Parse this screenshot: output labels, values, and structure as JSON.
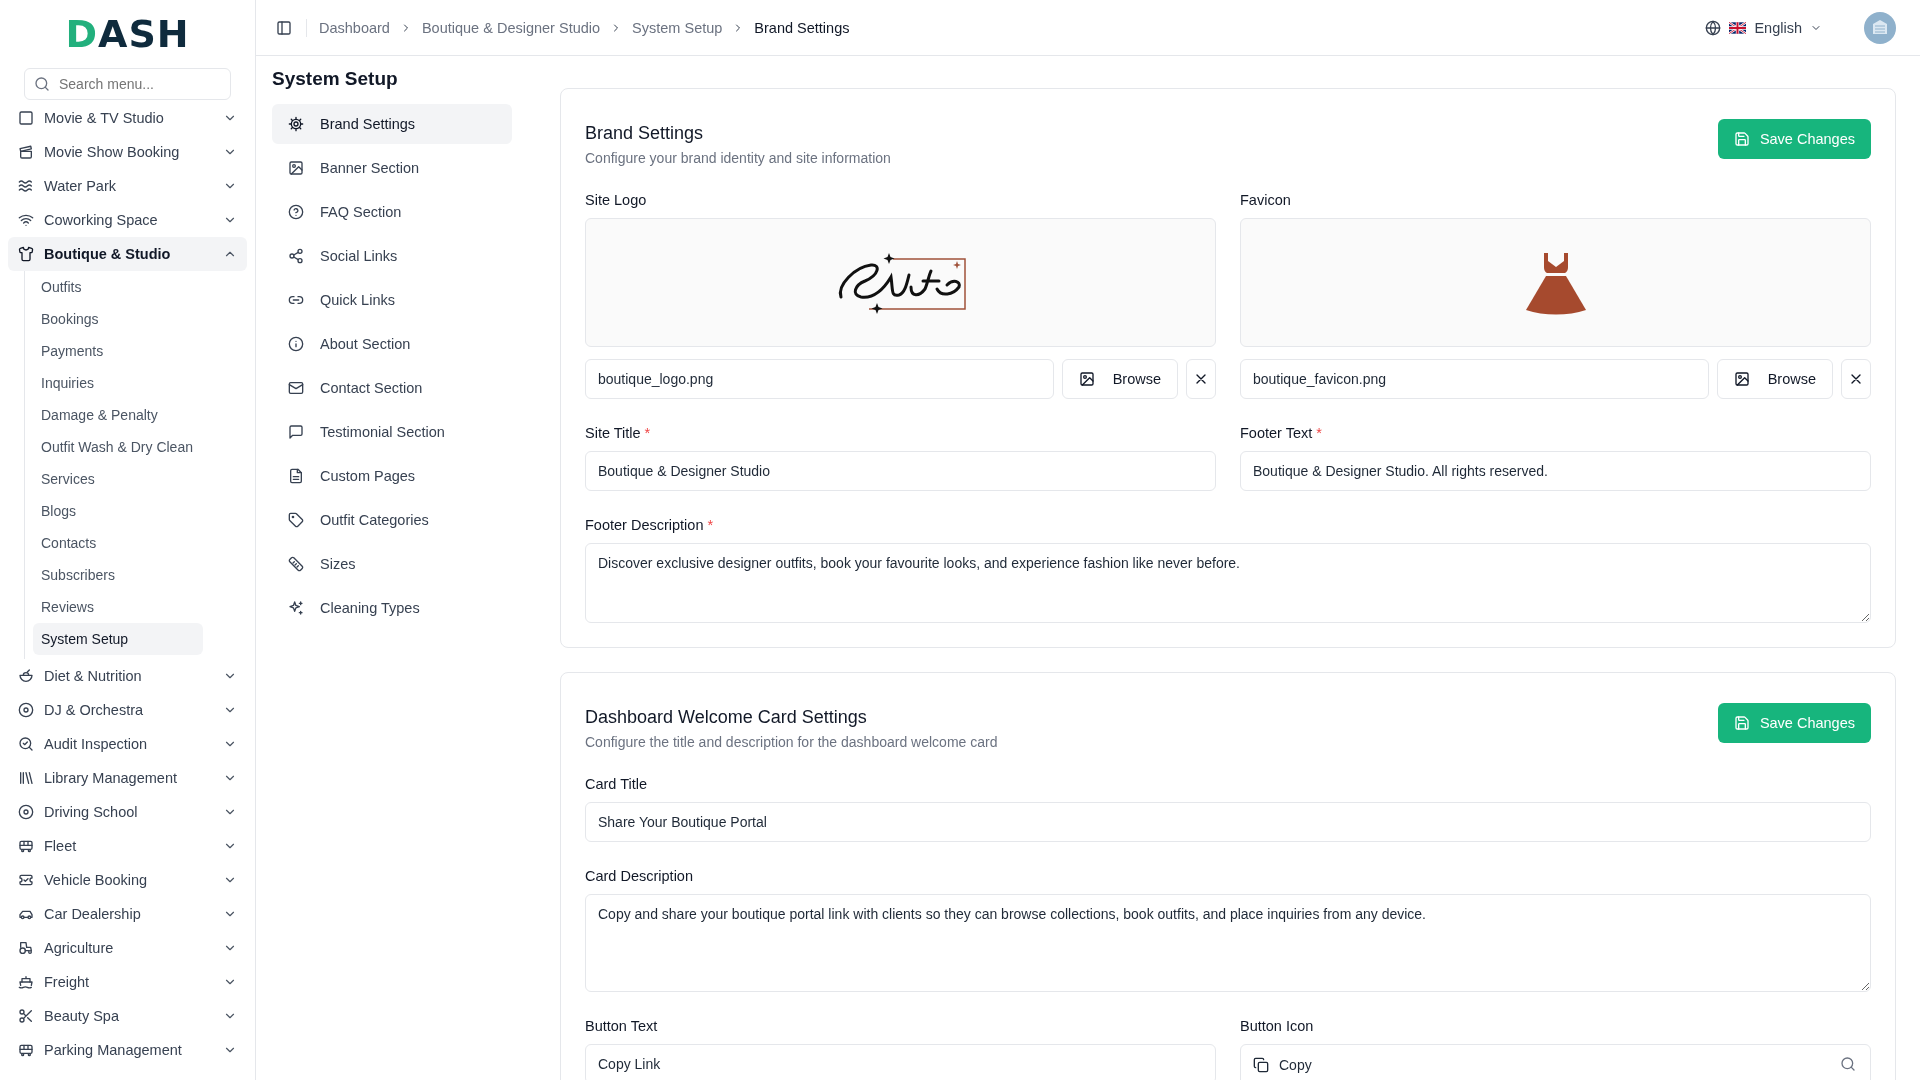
{
  "brand": {
    "logo": "DASH"
  },
  "search": {
    "placeholder": "Search menu..."
  },
  "sidebar": {
    "items": [
      {
        "label": "Movie & TV Studio",
        "expanded": false
      },
      {
        "label": "Movie Show Booking",
        "expanded": false
      },
      {
        "label": "Water Park",
        "expanded": false
      },
      {
        "label": "Coworking Space",
        "expanded": false
      },
      {
        "label": "Boutique & Studio",
        "expanded": true,
        "children": [
          {
            "label": "Outfits",
            "selected": false
          },
          {
            "label": "Bookings",
            "selected": false
          },
          {
            "label": "Payments",
            "selected": false
          },
          {
            "label": "Inquiries",
            "selected": false
          },
          {
            "label": "Damage & Penalty",
            "selected": false
          },
          {
            "label": "Outfit Wash & Dry Clean",
            "selected": false
          },
          {
            "label": "Services",
            "selected": false
          },
          {
            "label": "Blogs",
            "selected": false
          },
          {
            "label": "Contacts",
            "selected": false
          },
          {
            "label": "Subscribers",
            "selected": false
          },
          {
            "label": "Reviews",
            "selected": false
          },
          {
            "label": "System Setup",
            "selected": true
          }
        ]
      },
      {
        "label": "Diet & Nutrition",
        "expanded": false
      },
      {
        "label": "DJ & Orchestra",
        "expanded": false
      },
      {
        "label": "Audit Inspection",
        "expanded": false
      },
      {
        "label": "Library Management",
        "expanded": false
      },
      {
        "label": "Driving School",
        "expanded": false
      },
      {
        "label": "Fleet",
        "expanded": false
      },
      {
        "label": "Vehicle Booking",
        "expanded": false
      },
      {
        "label": "Car Dealership",
        "expanded": false
      },
      {
        "label": "Agriculture",
        "expanded": false
      },
      {
        "label": "Freight",
        "expanded": false
      },
      {
        "label": "Beauty Spa",
        "expanded": false
      },
      {
        "label": "Parking Management",
        "expanded": false
      }
    ]
  },
  "topbar": {
    "breadcrumbs": [
      "Dashboard",
      "Boutique & Designer Studio",
      "System Setup",
      "Brand Settings"
    ],
    "language": "English"
  },
  "page_title": "System Setup",
  "setup_menu": [
    {
      "label": "Brand Settings",
      "selected": true
    },
    {
      "label": "Banner Section",
      "selected": false
    },
    {
      "label": "FAQ Section",
      "selected": false
    },
    {
      "label": "Social Links",
      "selected": false
    },
    {
      "label": "Quick Links",
      "selected": false
    },
    {
      "label": "About Section",
      "selected": false
    },
    {
      "label": "Contact Section",
      "selected": false
    },
    {
      "label": "Testimonial Section",
      "selected": false
    },
    {
      "label": "Custom Pages",
      "selected": false
    },
    {
      "label": "Outfit Categories",
      "selected": false
    },
    {
      "label": "Sizes",
      "selected": false
    },
    {
      "label": "Cleaning Types",
      "selected": false
    }
  ],
  "brand_card": {
    "title": "Brand Settings",
    "subtitle": "Configure your brand identity and site information",
    "save": "Save Changes",
    "site_logo": {
      "label": "Site Logo",
      "file": "boutique_logo.png",
      "browse": "Browse"
    },
    "favicon": {
      "label": "Favicon",
      "file": "boutique_favicon.png",
      "browse": "Browse"
    },
    "site_title": {
      "label": "Site Title",
      "required_mark": "*",
      "value": "Boutique & Designer Studio"
    },
    "footer_text": {
      "label": "Footer Text",
      "required_mark": "*",
      "value": "Boutique & Designer Studio. All rights reserved."
    },
    "footer_description": {
      "label": "Footer Description",
      "required_mark": "*",
      "value": "Discover exclusive designer outfits, book your favourite looks, and experience fashion like never before."
    }
  },
  "welcome_card": {
    "title": "Dashboard Welcome Card Settings",
    "subtitle": "Configure the title and description for the dashboard welcome card",
    "save": "Save Changes",
    "card_title": {
      "label": "Card Title",
      "value": "Share Your Boutique Portal"
    },
    "card_description": {
      "label": "Card Description",
      "value": "Copy and share your boutique portal link with clients so they can browse collections, book outfits, and place inquiries from any device."
    },
    "button_text": {
      "label": "Button Text",
      "value": "Copy Link"
    },
    "button_icon": {
      "label": "Button Icon",
      "value": "Copy"
    }
  }
}
